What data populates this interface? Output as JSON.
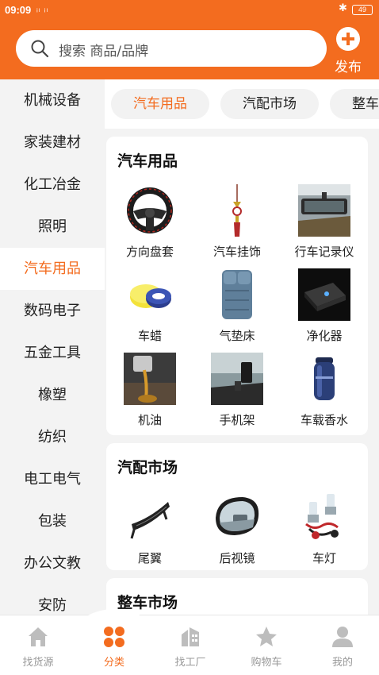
{
  "status_bar": {
    "time": "09:09",
    "signal": "ᵢₗ ᵢₗ",
    "bluetooth": "✱",
    "battery": "49"
  },
  "colors": {
    "accent": "#f36c1f",
    "background": "#f3f3f3"
  },
  "search": {
    "placeholder": "搜索 商品/品牌",
    "icon": "search-icon"
  },
  "publish": {
    "label": "发布",
    "icon": "plus-circle-icon"
  },
  "sidebar": {
    "items": [
      {
        "label": "机械设备",
        "active": false
      },
      {
        "label": "家装建材",
        "active": false
      },
      {
        "label": "化工冶金",
        "active": false
      },
      {
        "label": "照明",
        "active": false
      },
      {
        "label": "汽车用品",
        "active": true
      },
      {
        "label": "数码电子",
        "active": false
      },
      {
        "label": "五金工具",
        "active": false
      },
      {
        "label": "橡塑",
        "active": false
      },
      {
        "label": "纺织",
        "active": false
      },
      {
        "label": "电工电气",
        "active": false
      },
      {
        "label": "包装",
        "active": false
      },
      {
        "label": "办公文教",
        "active": false
      },
      {
        "label": "安防",
        "active": false
      }
    ]
  },
  "tabs": [
    {
      "label": "汽车用品",
      "active": true
    },
    {
      "label": "汽配市场",
      "active": false
    },
    {
      "label": "整车",
      "active": false
    }
  ],
  "sections": [
    {
      "title": "汽车用品",
      "products": [
        {
          "label": "方向盘套",
          "icon": "steering-wheel-cover-image"
        },
        {
          "label": "汽车挂饰",
          "icon": "car-pendant-image"
        },
        {
          "label": "行车记录仪",
          "icon": "dashcam-image"
        },
        {
          "label": "车蜡",
          "icon": "car-wax-image"
        },
        {
          "label": "气垫床",
          "icon": "air-mattress-image"
        },
        {
          "label": "净化器",
          "icon": "air-purifier-image"
        },
        {
          "label": "机油",
          "icon": "engine-oil-image"
        },
        {
          "label": "手机架",
          "icon": "phone-holder-image"
        },
        {
          "label": "车载香水",
          "icon": "car-perfume-image"
        }
      ]
    },
    {
      "title": "汽配市场",
      "products": [
        {
          "label": "尾翼",
          "icon": "spoiler-image"
        },
        {
          "label": "后视镜",
          "icon": "rearview-mirror-image"
        },
        {
          "label": "车灯",
          "icon": "headlight-image"
        }
      ]
    },
    {
      "title": "整车市场",
      "products": []
    }
  ],
  "bottom_nav": [
    {
      "label": "找货源",
      "icon": "home-icon",
      "active": false
    },
    {
      "label": "分类",
      "icon": "category-grid-icon",
      "active": true
    },
    {
      "label": "找工厂",
      "icon": "factory-icon",
      "active": false
    },
    {
      "label": "购物车",
      "icon": "star-icon",
      "active": false
    },
    {
      "label": "我的",
      "icon": "user-icon",
      "active": false
    }
  ]
}
